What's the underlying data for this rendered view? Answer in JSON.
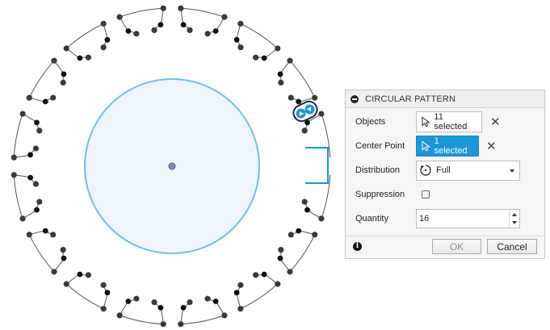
{
  "dialog": {
    "title": "CIRCULAR PATTERN",
    "objects": {
      "label": "Objects",
      "value": "11 selected"
    },
    "center_point": {
      "label": "Center Point",
      "value": "1 selected"
    },
    "distribution": {
      "label": "Distribution",
      "value": "Full"
    },
    "suppression": {
      "label": "Suppression",
      "checked": false
    },
    "quantity": {
      "label": "Quantity",
      "value": "16"
    },
    "ok_label": "OK",
    "cancel_label": "Cancel"
  },
  "sketch": {
    "pattern_count": 16,
    "center_circle_color": "#6ec1e8",
    "center_circle_fill": "#eef6fb",
    "profile_color": "#555555",
    "selected_color": "#1c96d6"
  },
  "colors": {
    "accent": "#1c96d6",
    "panel_bg": "#f6f6f6"
  }
}
